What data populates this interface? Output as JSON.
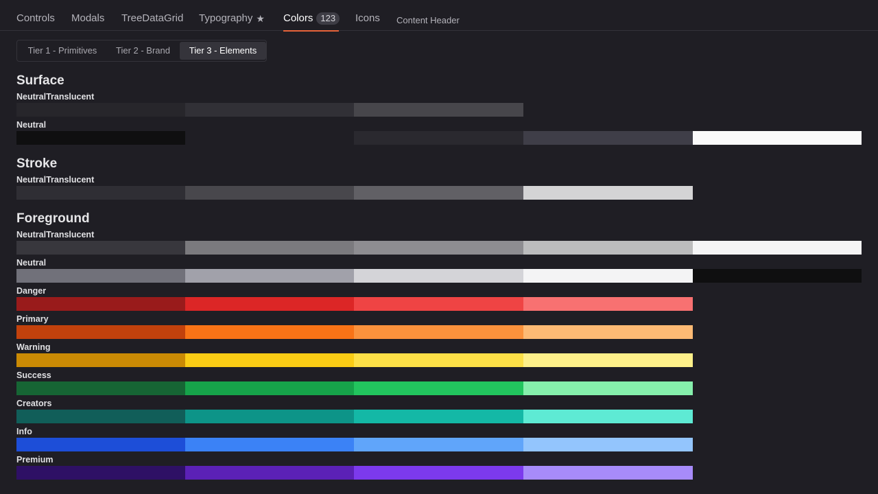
{
  "nav": {
    "tabs": [
      {
        "label": "Controls"
      },
      {
        "label": "Modals"
      },
      {
        "label": "TreeDataGrid"
      },
      {
        "label": "Typography",
        "icon": "star-icon"
      },
      {
        "label": "Colors",
        "badge": "123",
        "active": true
      },
      {
        "label": "Icons"
      },
      {
        "label": "Content Header"
      }
    ]
  },
  "tiers": {
    "items": [
      {
        "label": "Tier 1 - Primitives"
      },
      {
        "label": "Tier 2 - Brand"
      },
      {
        "label": "Tier 3 - Elements",
        "active": true
      }
    ]
  },
  "sections": [
    {
      "title": "Surface",
      "rows": [
        {
          "label": "NeutralTranslucent",
          "colors": [
            "#27262b",
            "#313036",
            "#47464b",
            null,
            null
          ]
        },
        {
          "label": "Neutral",
          "colors": [
            "#0f0f10",
            null,
            "#2a292f",
            "#3f3e48",
            "#fafafa"
          ]
        }
      ]
    },
    {
      "title": "Stroke",
      "rows": [
        {
          "label": "NeutralTranslucent",
          "colors": [
            "#2f2e34",
            "#48474c",
            "#616065",
            "#d4d4d5",
            null
          ]
        }
      ]
    },
    {
      "title": "Foreground",
      "rows": [
        {
          "label": "NeutralTranslucent",
          "colors": [
            "#38373d",
            "#7b7a7e",
            "#8e8d91",
            "#bcbcbd",
            "#f4f4f5"
          ]
        },
        {
          "label": "Neutral",
          "colors": [
            "#71717a",
            "#a1a1aa",
            "#d4d4d8",
            "#f4f4f5",
            "#0f0f10"
          ]
        },
        {
          "label": "Danger",
          "colors": [
            "#991b1b",
            "#dc2626",
            "#ef4444",
            "#f87171",
            null
          ]
        },
        {
          "label": "Primary",
          "colors": [
            "#c2410c",
            "#f97316",
            "#fb923c",
            "#fdba74",
            null
          ]
        },
        {
          "label": "Warning",
          "colors": [
            "#ca8a04",
            "#facc15",
            "#fde047",
            "#fef08a",
            null
          ]
        },
        {
          "label": "Success",
          "colors": [
            "#166534",
            "#16a34a",
            "#22c55e",
            "#86efac",
            null
          ]
        },
        {
          "label": "Creators",
          "colors": [
            "#115e59",
            "#0d9488",
            "#14b8a6",
            "#5eead4",
            null
          ]
        },
        {
          "label": "Info",
          "colors": [
            "#1d4ed8",
            "#3b82f6",
            "#60a5fa",
            "#93c5fd",
            null
          ]
        },
        {
          "label": "Premium",
          "colors": [
            "#2e1065",
            "#5b21b6",
            "#7c3aed",
            "#a78bfa",
            null
          ]
        }
      ]
    }
  ]
}
